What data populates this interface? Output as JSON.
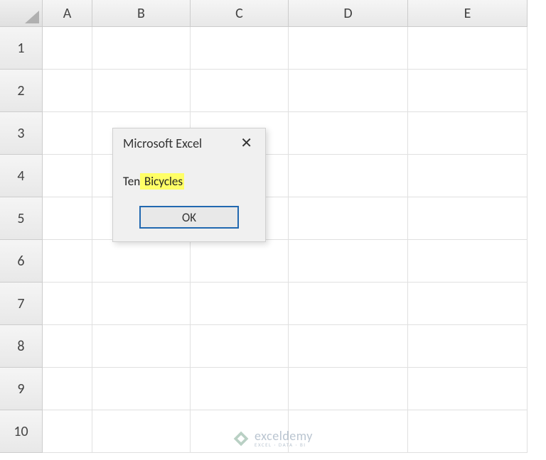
{
  "columns": [
    "A",
    "B",
    "C",
    "D",
    "E"
  ],
  "rows": [
    "1",
    "2",
    "3",
    "4",
    "5",
    "6",
    "7",
    "8",
    "9",
    "10"
  ],
  "dialog": {
    "title": "Microsoft Excel",
    "message_prefix": "Ten",
    "message_highlight": " Bicycles",
    "ok_label": "OK"
  },
  "watermark": {
    "main": "exceldemy",
    "sub": "EXCEL · DATA · BI"
  }
}
